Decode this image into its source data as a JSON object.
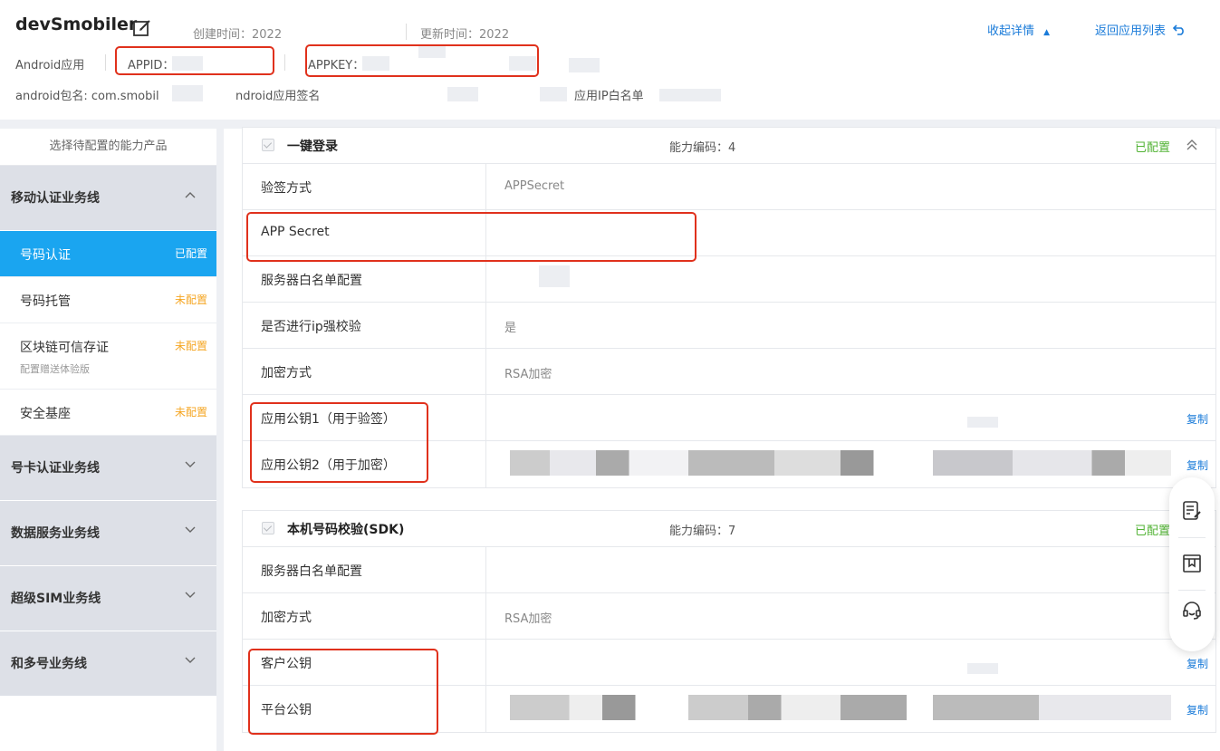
{
  "header": {
    "app_name": "devSmobiler",
    "created_label": "创建时间：",
    "created_value": "2022",
    "updated_label": "更新时间：",
    "updated_value": "2022",
    "collapse_link": "收起详情",
    "back_link": "返回应用列表",
    "platform": "Android应用",
    "appid_label": "APPID：",
    "appkey_label": "APPKEY：",
    "package_label": "android包名: com.smobil",
    "signature_label": "ndroid应用签名",
    "ip_whitelist_label": "应用IP白名单"
  },
  "sidebar": {
    "title": "选择待配置的能力产品",
    "groups": [
      {
        "label": "移动认证业务线",
        "items": [
          {
            "label": "号码认证",
            "status": "已配置"
          },
          {
            "label": "号码托管",
            "status": "未配置"
          },
          {
            "label": "区块链可信存证",
            "status": "未配置",
            "sub": "配置赠送体验版"
          },
          {
            "label": "安全基座",
            "status": "未配置"
          }
        ]
      },
      {
        "label": "号卡认证业务线"
      },
      {
        "label": "数据服务业务线"
      },
      {
        "label": "超级SIM业务线"
      },
      {
        "label": "和多号业务线"
      }
    ]
  },
  "sections": [
    {
      "title": "一键登录",
      "code_label": "能力编码：4",
      "status": "已配置",
      "rows": [
        {
          "key": "验签方式",
          "value": "APPSecret"
        },
        {
          "key": "APP Secret",
          "value": ""
        },
        {
          "key": "服务器白名单配置",
          "value": ""
        },
        {
          "key": "是否进行ip强校验",
          "value": "是"
        },
        {
          "key": "加密方式",
          "value": "RSA加密"
        },
        {
          "key": "应用公钥1（用于验签）",
          "value": "",
          "copy": "复制"
        },
        {
          "key": "应用公钥2（用于加密）",
          "value": "",
          "copy": "复制"
        }
      ]
    },
    {
      "title": "本机号码校验(SDK)",
      "code_label": "能力编码：7",
      "status": "已配置",
      "rows": [
        {
          "key": "服务器白名单配置",
          "value": ""
        },
        {
          "key": "加密方式",
          "value": "RSA加密"
        },
        {
          "key": "客户公钥",
          "value": "",
          "copy": "复制"
        },
        {
          "key": "平台公钥",
          "value": "",
          "copy": "复制"
        }
      ]
    }
  ],
  "colors": {
    "accent": "#1aa5f0",
    "link": "#1a7bd9",
    "configured": "#52b335",
    "unconfigured": "#f5a623",
    "highlight": "#e0311c"
  },
  "icons": [
    "edit-icon",
    "chevron-up-icon",
    "chevron-down-icon",
    "undo-icon",
    "notes-icon",
    "book-icon",
    "headset-icon"
  ]
}
